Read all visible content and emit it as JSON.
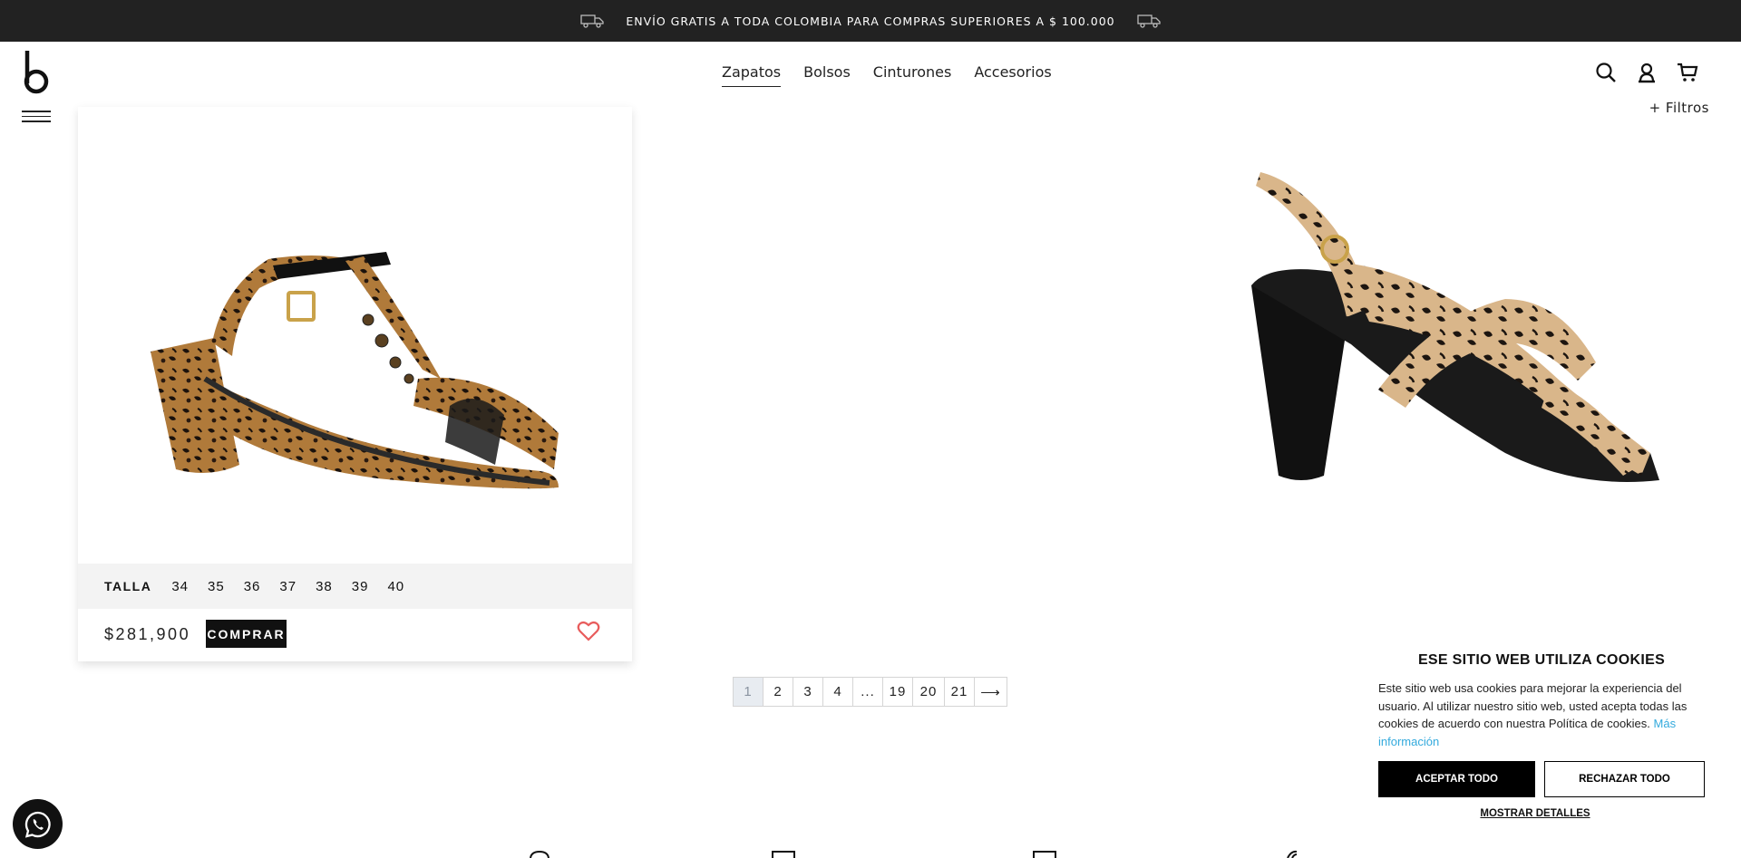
{
  "announcement": {
    "text": "ENVÍO GRATIS A TODA COLOMBIA PARA COMPRAS SUPERIORES A $ 100.000"
  },
  "header": {
    "nav": [
      "Zapatos",
      "Bolsos",
      "Cinturones",
      "Accesorios"
    ],
    "active_nav": "Zapatos",
    "icons": [
      "search-icon",
      "user-icon",
      "cart-icon"
    ]
  },
  "filters": {
    "label": "+ Filtros"
  },
  "product": {
    "size_label": "TALLA",
    "sizes": [
      "34",
      "35",
      "36",
      "37",
      "38",
      "39",
      "40"
    ],
    "price": "$281,900",
    "buy_label": "COMPRAR"
  },
  "pagination": {
    "pages": [
      "1",
      "2",
      "3",
      "4",
      "...",
      "19",
      "20",
      "21"
    ],
    "current": "1",
    "next_label": "⟶"
  },
  "cookies": {
    "title": "ESE SITIO WEB UTILIZA COOKIES",
    "text": "Este sitio web usa cookies para mejorar la experiencia del usuario. Al utilizar nuestro sitio web, usted acepta todas las cookies de acuerdo con nuestra Política de cookies.",
    "more_link": "Más información",
    "accept": "ACEPTAR TODO",
    "reject": "RECHAZAR TODO",
    "details": "MOSTRAR DETALLES"
  },
  "colors": {
    "announce_bg": "#222222",
    "link": "#33aadd",
    "heart": "#e85c5c",
    "leopard_base": "#b07a3a"
  }
}
